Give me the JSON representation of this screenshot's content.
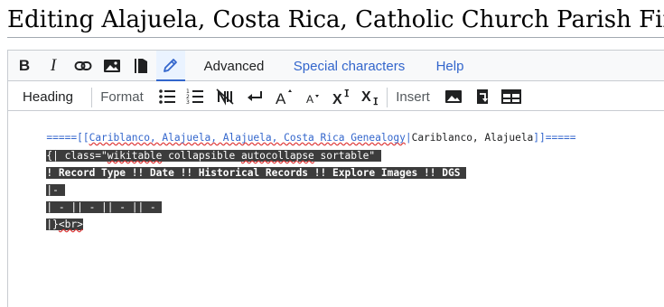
{
  "page": {
    "title": "Editing Alajuela, Costa Rica, Catholic Church Parish Finding Aid"
  },
  "toolbar": {
    "bold_label": "B",
    "italic_label": "I",
    "advanced_label": "Advanced",
    "special_characters_label": "Special characters",
    "help_label": "Help"
  },
  "toolbar2": {
    "heading_label": "Heading",
    "format_label": "Format",
    "insert_label": "Insert"
  },
  "editor": {
    "line1": {
      "prefix": "=====[[",
      "link_target": "Cariblanco, Alajuela, Alajuela, Costa Rica Genealogy",
      "pipe": "|",
      "link_text": "Cariblanco, Alajuela",
      "suffix": "]]====="
    },
    "line2": {
      "p1": "{| class=\"",
      "p2": "wikitable",
      "p3": " collapsible ",
      "p4": "autocollapse",
      "p5": " sortable\" "
    },
    "line3": "! Record Type !! Date !! Historical Records !! Explore Images !! DGS ",
    "line4": "|- ",
    "line5": "| - || - || - || - ",
    "line6": {
      "p1": "|}",
      "p2": "<br>"
    }
  },
  "colors": {
    "link": "#3366cc",
    "selection_bg": "#3c3c3c",
    "active_tool_bg": "#eaf3ff",
    "toolbar_bg": "#f8f9fa",
    "border": "#c8ccd1"
  }
}
